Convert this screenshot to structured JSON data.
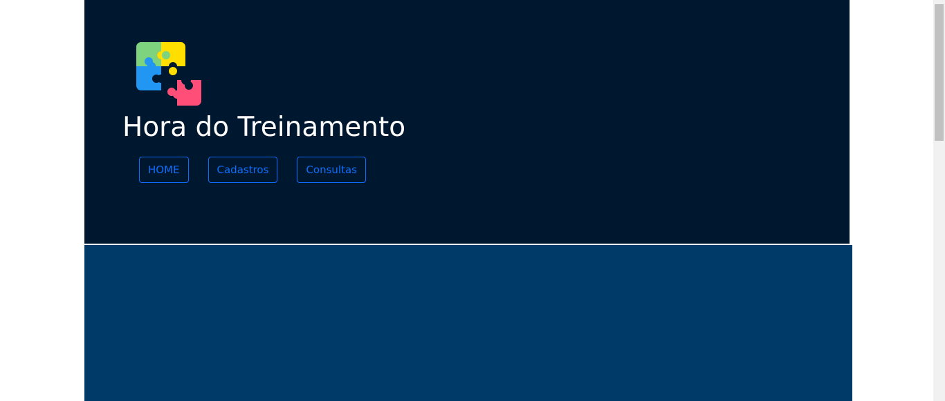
{
  "header": {
    "title": "Hora do Treinamento",
    "logo_icon": "puzzle-icon",
    "logo_colors": [
      "#7ed37f",
      "#ffde00",
      "#2196f3",
      "#ff4f78"
    ],
    "background": "#00182f"
  },
  "nav": {
    "home_label": "HOME",
    "cadastros_label": "Cadastros",
    "consultas_label": "Consultas",
    "accent": "#0d6efd"
  },
  "main": {
    "background": "#003a69"
  }
}
